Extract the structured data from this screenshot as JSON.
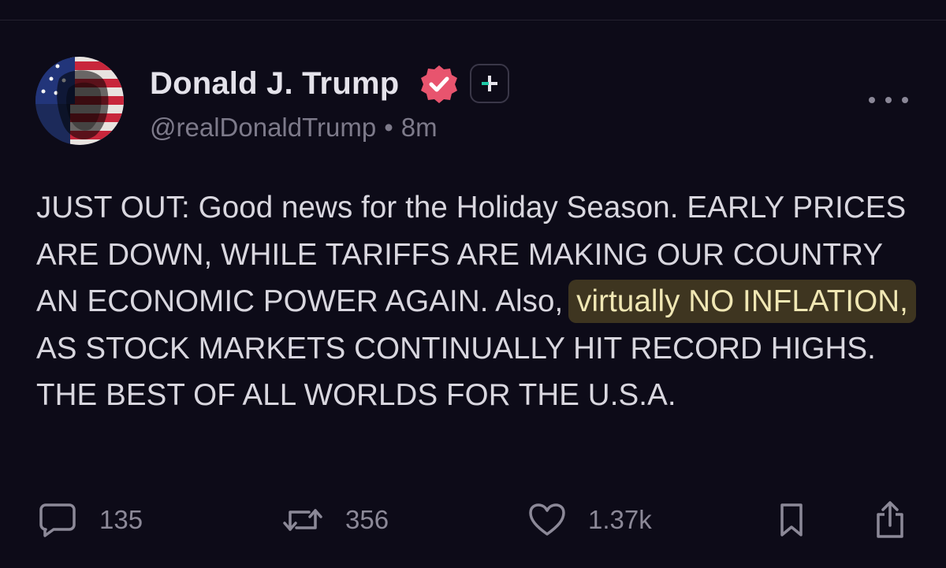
{
  "post": {
    "author": {
      "display_name": "Donald J. Trump",
      "handle": "@realDonaldTrump",
      "separator": "•",
      "time_ago": "8m"
    },
    "body": {
      "part1": "JUST OUT: Good news for the Holiday Season. EARLY PRICES ARE DOWN, WHILE TARIFFS ARE MAKING OUR COUNTRY AN ECONOMIC POWER AGAIN. Also, ",
      "highlight": "virtually NO INFLATION,",
      "part2": " AS STOCK MARKETS CONTINUALLY HIT RECORD HIGHS. THE BEST OF ALL WORLDS FOR THE U.S.A."
    },
    "stats": {
      "replies": "135",
      "reposts": "356",
      "likes": "1.37k"
    }
  },
  "icons": {
    "verified": "verified-badge-icon",
    "follow": "plus-icon",
    "more": "more-icon",
    "reply": "comment-icon",
    "repost": "repost-icon",
    "like": "heart-icon",
    "bookmark": "bookmark-icon",
    "share": "share-icon"
  },
  "colors": {
    "background": "#0d0b18",
    "verified_badge": "#e8546e",
    "follow_plus": "#1fc9a7",
    "highlight_bg": "#3e3520",
    "highlight_text": "#f0e7b4"
  }
}
